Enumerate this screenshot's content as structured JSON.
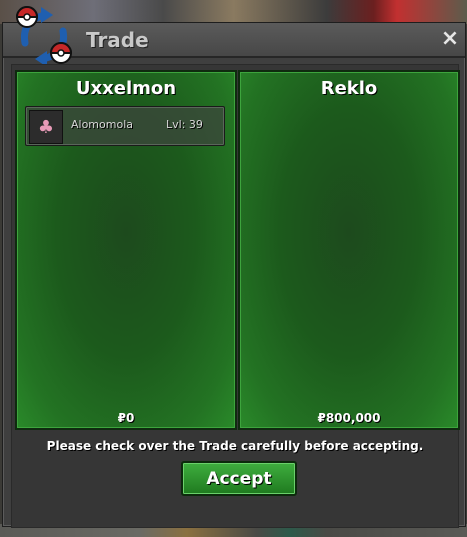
{
  "window": {
    "title": "Trade",
    "close_symbol": "×"
  },
  "left_player": {
    "name": "Uxxelmon",
    "money": "₽0",
    "items": [
      {
        "icon": "pink-pokemon-icon",
        "name": "Alomomola",
        "level": "Lvl: 39"
      }
    ]
  },
  "right_player": {
    "name": "Reklo",
    "money": "₽800,000",
    "items": []
  },
  "notice": "Please check over the Trade carefully before accepting.",
  "accept_label": "Accept",
  "colors": {
    "panel_green": "#237323",
    "button_green": "#2f942f",
    "window_gray": "#3f3f3f",
    "logo_red": "#c62828",
    "logo_blue": "#1f5fb0"
  }
}
